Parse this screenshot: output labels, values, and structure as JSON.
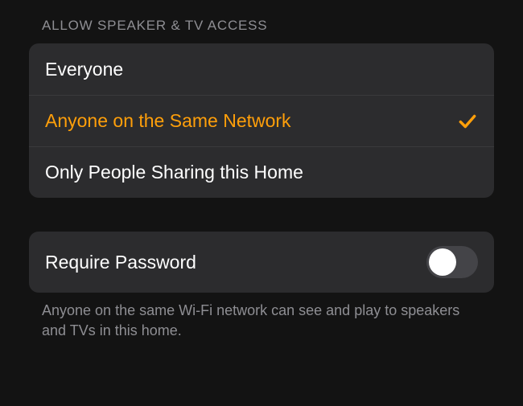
{
  "section": {
    "header": "ALLOW SPEAKER & TV ACCESS",
    "options": [
      {
        "label": "Everyone",
        "selected": false
      },
      {
        "label": "Anyone on the Same Network",
        "selected": true
      },
      {
        "label": "Only People Sharing this Home",
        "selected": false
      }
    ]
  },
  "password": {
    "label": "Require Password",
    "enabled": false
  },
  "footer": {
    "text": "Anyone on the same Wi-Fi network can see and play to speakers and TVs in this home."
  },
  "colors": {
    "accent": "#ff9f0a",
    "background": "#131313",
    "groupBackground": "#2c2c2e",
    "secondaryText": "#8e8e93"
  }
}
